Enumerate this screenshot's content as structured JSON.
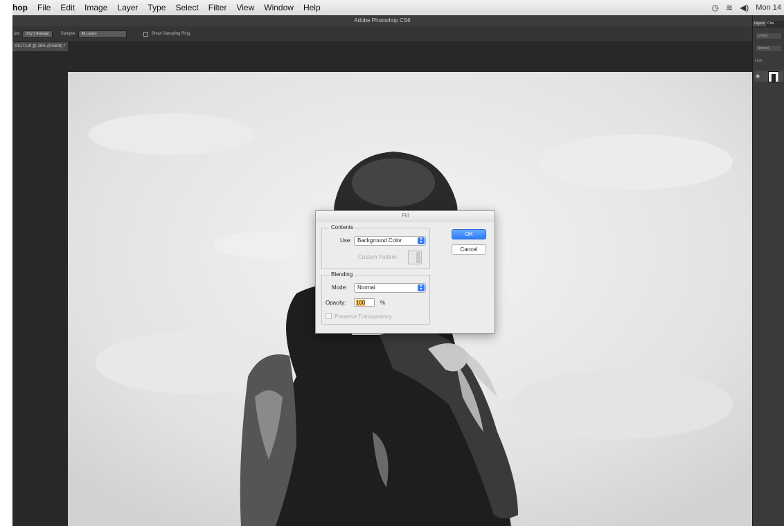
{
  "menubar": {
    "app": "hop",
    "menus": [
      "File",
      "Edit",
      "Image",
      "Layer",
      "Type",
      "Select",
      "Filter",
      "View",
      "Window",
      "Help"
    ],
    "clock": "Mon 14"
  },
  "app_title": "Adobe Photoshop CS6",
  "options_bar": {
    "size_label": "ize:",
    "size_value": "3 by 3 Average",
    "sample_label": "Sample:",
    "sample_value": "All Layers",
    "sampling_ring_label": "Show Sampling Ring"
  },
  "document_tab": {
    "label": "05172.tif @ 25% (RGB/8) *",
    "close": "×"
  },
  "layers_panel": {
    "tabs": [
      "Layers",
      "Cha"
    ],
    "kind_label": "ρ Kind",
    "blend_label": "Normal",
    "lock_label": "Lock:"
  },
  "fill_dialog": {
    "title": "Fill",
    "contents_group": "Contents",
    "use_label": "Use:",
    "use_value": "Background Color",
    "custom_pattern_label": "Custom Pattern:",
    "blending_group": "Blending",
    "mode_label": "Mode:",
    "mode_value": "Normal",
    "opacity_label": "Opacity:",
    "opacity_value": "100",
    "opacity_unit": "%",
    "preserve_label": "Preserve Transparency",
    "ok_label": "OK",
    "cancel_label": "Cancel"
  }
}
